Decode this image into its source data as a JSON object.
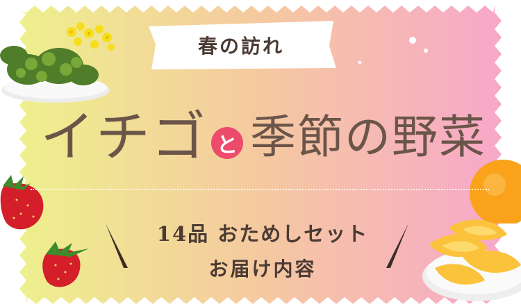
{
  "banner": {
    "tag_label": "春の訪れ",
    "title_left": "イチゴ",
    "title_connector": "と",
    "title_right": "季節の野菜",
    "subtitle_line1": "14品 おためしセット",
    "subtitle_line2": "お届け内容"
  },
  "colors": {
    "gradient_left": "#eef08d",
    "gradient_mid": "#f5c9a0",
    "gradient_right": "#f7a8c9",
    "title_text": "#6b5549",
    "body_text": "#4a3a33",
    "accent_pink": "#ec4b6c"
  },
  "decorations": [
    "greens-bowl-image",
    "yellow-flowers-image",
    "strawberry-image",
    "strawberry-image",
    "orange-image",
    "grapefruit-segments-image"
  ]
}
